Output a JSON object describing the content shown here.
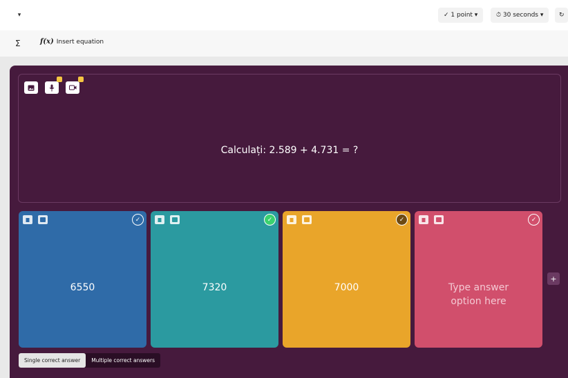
{
  "toolbar": {
    "question_type_caret": "▾",
    "points": "✓ 1 point ▾",
    "time": "⏱ 30 seconds ▾",
    "edge_icon": "↻"
  },
  "equation_bar": {
    "sigma": "Σ",
    "fx": "f(x)",
    "insert_label": "Insert equation"
  },
  "question": {
    "text": "Calculați: 2.589 + 4.731 = ?",
    "media_icons": [
      "image-icon",
      "microphone-icon",
      "video-icon"
    ]
  },
  "options": [
    {
      "value": "6550",
      "color": "#2f6ba8",
      "check_color": "#2f6ba8",
      "correct": false
    },
    {
      "value": "7320",
      "color": "#2b9aa0",
      "check_color": "#3bd16f",
      "correct": true
    },
    {
      "value": "7000",
      "color": "#e9a52a",
      "check_color": "#6e4a12",
      "correct": false
    },
    {
      "value": "Type answer option here",
      "color": "#d14f6c",
      "check_color": "#d14f6c",
      "correct": false,
      "placeholder": true
    }
  ],
  "add_option": "+",
  "answer_mode": {
    "single": "Single correct answer",
    "multiple": "Multiple correct answers",
    "selected": "single"
  },
  "colors": {
    "editor_bg": "#461a3d",
    "accent_lock": "#f4c542"
  }
}
